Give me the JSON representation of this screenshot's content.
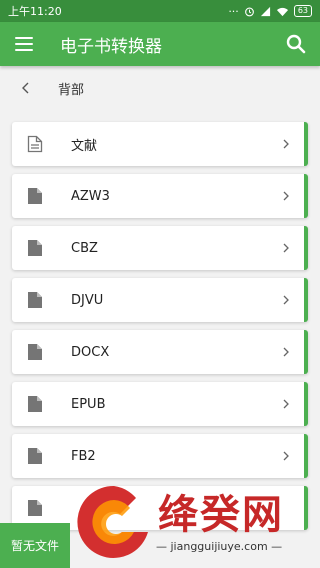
{
  "status_bar": {
    "time": "上午11:20",
    "battery": "63"
  },
  "app_bar": {
    "title": "电子书转换器",
    "menu_icon": "menu-icon",
    "search_icon": "search-icon"
  },
  "breadcrumb": {
    "label": "背部"
  },
  "items": [
    {
      "label": "文献",
      "icon": "document-outline-icon"
    },
    {
      "label": "AZW3",
      "icon": "file-icon"
    },
    {
      "label": "CBZ",
      "icon": "file-icon"
    },
    {
      "label": "DJVU",
      "icon": "file-icon"
    },
    {
      "label": "DOCX",
      "icon": "file-icon"
    },
    {
      "label": "EPUB",
      "icon": "file-icon"
    },
    {
      "label": "FB2",
      "icon": "file-icon"
    },
    {
      "label": "",
      "icon": "file-icon"
    }
  ],
  "toast": {
    "text": "暂无文件"
  },
  "watermark": {
    "brand": "绛癸网",
    "url": "— jiangguijiuye.com —"
  },
  "colors": {
    "primary": "#4caf50",
    "status_bar": "#388e3c",
    "watermark": "#c62828"
  }
}
